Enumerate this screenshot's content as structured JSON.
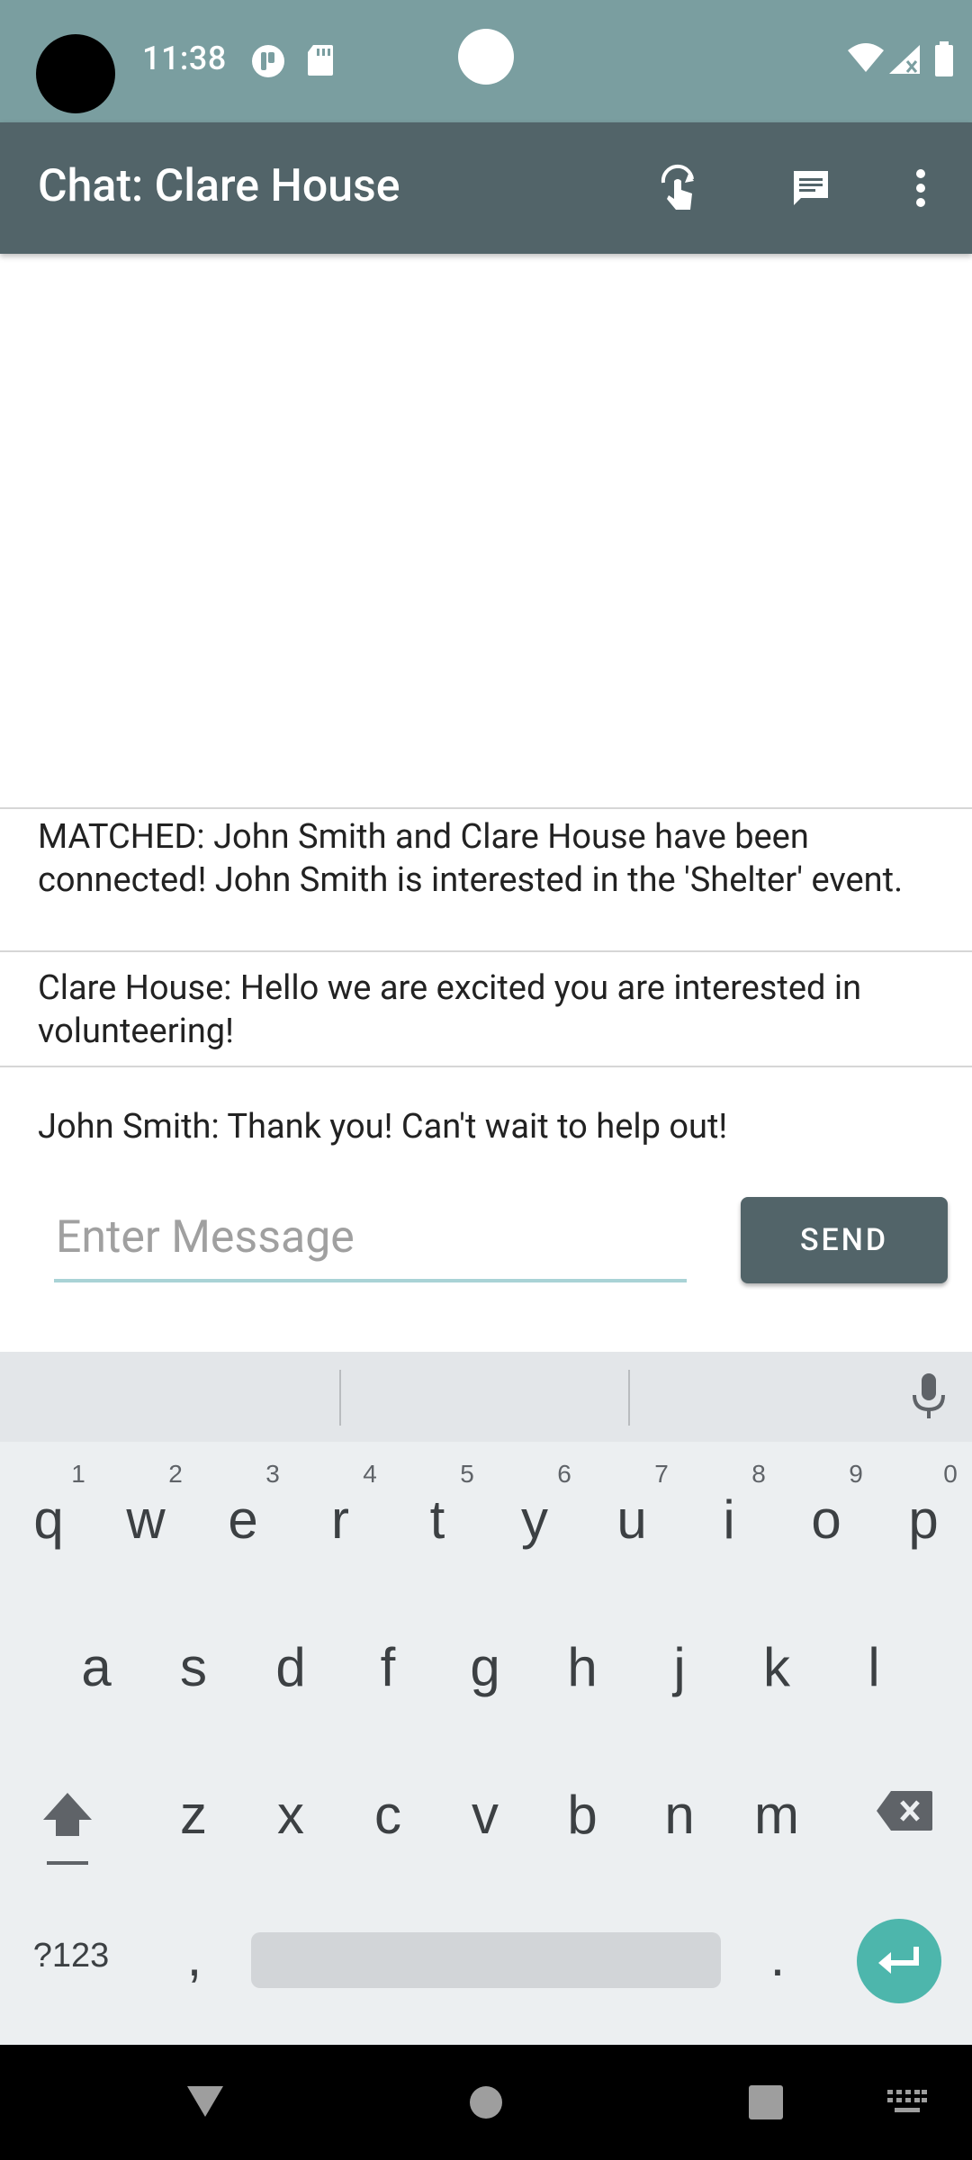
{
  "status_bar": {
    "time": "11:38"
  },
  "toolbar": {
    "title": "Chat: Clare House"
  },
  "messages": [
    {
      "text": "MATCHED: John Smith and Clare House have been connected! John Smith is interested in the 'Shelter' event."
    },
    {
      "text": "Clare House: Hello we are excited you are interested in volunteering!"
    },
    {
      "text": "John Smith: Thank you! Can't wait to help out!"
    }
  ],
  "composer": {
    "placeholder": "Enter Message",
    "value": "",
    "send_label": "SEND"
  },
  "keyboard": {
    "row1": [
      "q",
      "w",
      "e",
      "r",
      "t",
      "y",
      "u",
      "i",
      "o",
      "p"
    ],
    "row1_hints": [
      "1",
      "2",
      "3",
      "4",
      "5",
      "6",
      "7",
      "8",
      "9",
      "0"
    ],
    "row2": [
      "a",
      "s",
      "d",
      "f",
      "g",
      "h",
      "j",
      "k",
      "l"
    ],
    "row3": [
      "z",
      "x",
      "c",
      "v",
      "b",
      "n",
      "m"
    ],
    "symbols_label": "?123",
    "comma": ",",
    "period": "."
  },
  "colors": {
    "status_bar": "#7a9ea0",
    "toolbar": "#526469",
    "send_button": "#526469",
    "enter_key": "#4db6ac"
  }
}
